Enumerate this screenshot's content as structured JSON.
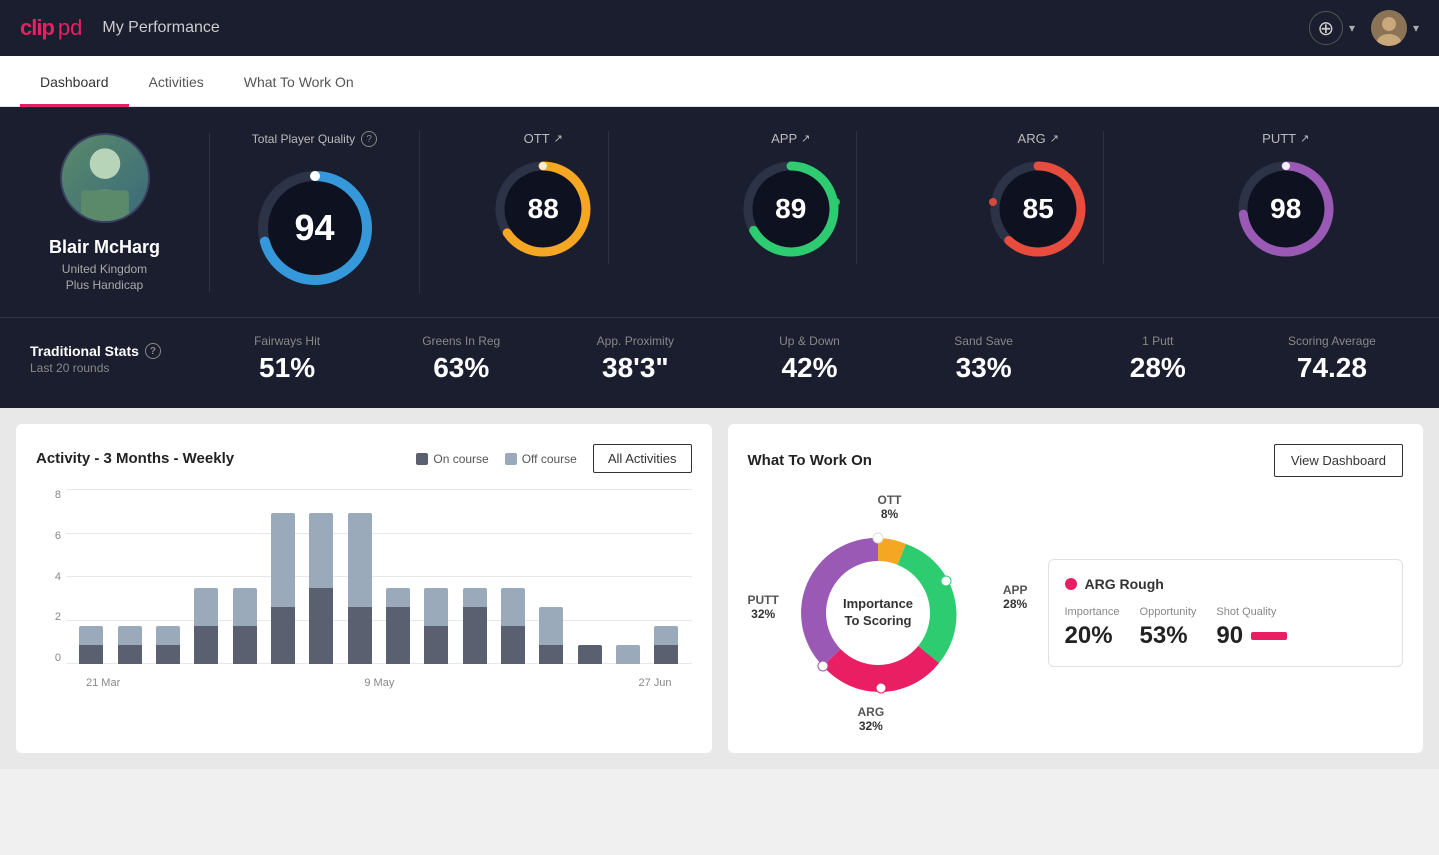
{
  "app": {
    "logo": "clippd",
    "logo_clip": "clip",
    "logo_pd": "pd"
  },
  "header": {
    "title": "My Performance",
    "add_button_label": "+",
    "dropdown_arrow": "▾"
  },
  "tabs": [
    {
      "id": "dashboard",
      "label": "Dashboard",
      "active": true
    },
    {
      "id": "activities",
      "label": "Activities",
      "active": false
    },
    {
      "id": "what-to-work-on",
      "label": "What To Work On",
      "active": false
    }
  ],
  "player": {
    "name": "Blair McHarg",
    "country": "United Kingdom",
    "handicap": "Plus Handicap"
  },
  "total_quality": {
    "label": "Total Player Quality",
    "value": "94"
  },
  "categories": [
    {
      "id": "ott",
      "label": "OTT",
      "value": "88",
      "color": "#f5a623",
      "stroke_color": "#f5a623"
    },
    {
      "id": "app",
      "label": "APP",
      "value": "89",
      "color": "#2ecc71",
      "stroke_color": "#2ecc71"
    },
    {
      "id": "arg",
      "label": "ARG",
      "value": "85",
      "color": "#e74c3c",
      "stroke_color": "#e74c3c"
    },
    {
      "id": "putt",
      "label": "PUTT",
      "value": "98",
      "color": "#9b59b6",
      "stroke_color": "#9b59b6"
    }
  ],
  "trad_stats": {
    "label": "Traditional Stats",
    "period": "Last 20 rounds",
    "items": [
      {
        "label": "Fairways Hit",
        "value": "51%"
      },
      {
        "label": "Greens In Reg",
        "value": "63%"
      },
      {
        "label": "App. Proximity",
        "value": "38'3\""
      },
      {
        "label": "Up & Down",
        "value": "42%"
      },
      {
        "label": "Sand Save",
        "value": "33%"
      },
      {
        "label": "1 Putt",
        "value": "28%"
      },
      {
        "label": "Scoring Average",
        "value": "74.28"
      }
    ]
  },
  "activity_chart": {
    "title": "Activity - 3 Months - Weekly",
    "legend": {
      "on_course": "On course",
      "off_course": "Off course"
    },
    "button": "All Activities",
    "y_labels": [
      "8",
      "6",
      "4",
      "2",
      "0"
    ],
    "x_labels": [
      "21 Mar",
      "9 May",
      "27 Jun"
    ],
    "bars": [
      {
        "on": 1,
        "off": 1
      },
      {
        "on": 1,
        "off": 1
      },
      {
        "on": 1,
        "off": 1
      },
      {
        "on": 2,
        "off": 2
      },
      {
        "on": 2,
        "off": 2
      },
      {
        "on": 3,
        "off": 5
      },
      {
        "on": 4,
        "off": 4
      },
      {
        "on": 3,
        "off": 5
      },
      {
        "on": 3,
        "off": 1
      },
      {
        "on": 2,
        "off": 2
      },
      {
        "on": 3,
        "off": 1
      },
      {
        "on": 2,
        "off": 2
      },
      {
        "on": 1,
        "off": 2
      },
      {
        "on": 1,
        "off": 0
      },
      {
        "on": 0,
        "off": 1
      },
      {
        "on": 1,
        "off": 1
      }
    ]
  },
  "what_to_work_on": {
    "title": "What To Work On",
    "button": "View Dashboard",
    "donut_center": "Importance\nTo Scoring",
    "segments": [
      {
        "label": "OTT",
        "value": "8%",
        "color": "#f5a623",
        "angle": 0,
        "size": 8
      },
      {
        "label": "APP",
        "value": "28%",
        "color": "#2ecc71",
        "angle": 90,
        "size": 28
      },
      {
        "label": "ARG",
        "value": "32%",
        "color": "#e74c3c",
        "angle": 200,
        "size": 32
      },
      {
        "label": "PUTT",
        "value": "32%",
        "color": "#9b59b6",
        "angle": 295,
        "size": 32
      }
    ],
    "card": {
      "title": "ARG Rough",
      "dot_color": "#e91e63",
      "metrics": [
        {
          "label": "Importance",
          "value": "20%"
        },
        {
          "label": "Opportunity",
          "value": "53%"
        },
        {
          "label": "Shot Quality",
          "value": "90"
        }
      ]
    }
  },
  "colors": {
    "primary": "#e91e63",
    "background_dark": "#1a1e2e",
    "accent_blue": "#3498db",
    "bar_on": "#5a6070",
    "bar_off": "#8a9aaa"
  }
}
